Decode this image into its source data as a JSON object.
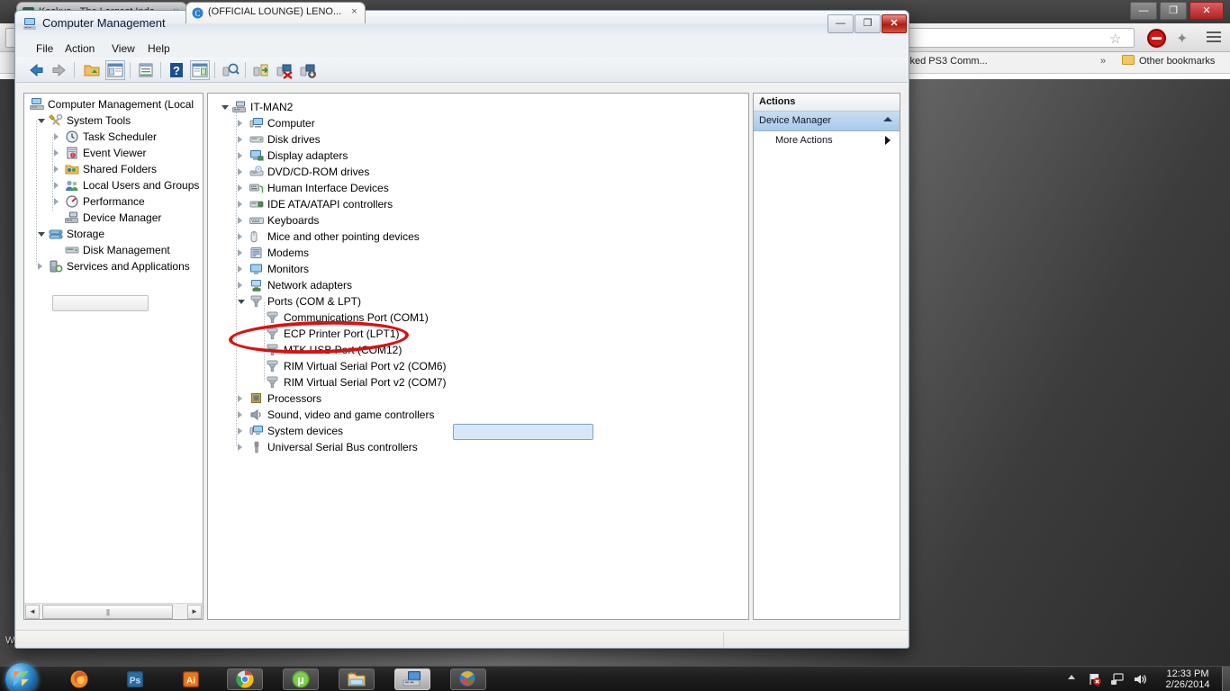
{
  "desktop": {
    "icon_label_partial": "W"
  },
  "browser": {
    "tabs": [
      {
        "title": "Kaskus - The Largest Indo...",
        "close_label": "×",
        "favicon": "kaskus-favicon"
      },
      {
        "title": "(OFFICIAL LOUNGE) LENO...",
        "close_label": "×",
        "favicon": "chrome-page-favicon"
      }
    ],
    "omnibox_value": "",
    "omnibox_placeholder": "",
    "star_glyph": "☆",
    "ext_glyph": "✦",
    "bookmarks": {
      "truncated_item": "cked PS3 Comm...",
      "overflow_glyph": "»",
      "other_bookmarks": "Other bookmarks"
    },
    "window_buttons": {
      "minimize": "—",
      "maximize": "❐",
      "close": "✕"
    }
  },
  "computer_management": {
    "title": "Computer Management",
    "window_buttons": {
      "minimize": "—",
      "maximize": "❐",
      "close": "✕"
    },
    "menu": [
      "File",
      "Action",
      "View",
      "Help"
    ],
    "toolbar_icons": [
      "back-arrow-icon",
      "forward-arrow-icon",
      "up-folder-icon",
      "show-hide-tree-icon",
      "properties-icon",
      "help-icon",
      "show-hide-action-pane-icon",
      "scan-hardware-icon",
      "update-driver-icon",
      "uninstall-device-icon",
      "disable-device-icon"
    ],
    "left_tree": [
      {
        "label": "Computer Management (Local",
        "level": 0,
        "twisty": "none",
        "icon": "computer-management-icon"
      },
      {
        "label": "System Tools",
        "level": 1,
        "twisty": "open",
        "icon": "system-tools-icon"
      },
      {
        "label": "Task Scheduler",
        "level": 2,
        "twisty": "closed",
        "icon": "task-scheduler-icon"
      },
      {
        "label": "Event Viewer",
        "level": 2,
        "twisty": "closed",
        "icon": "event-viewer-icon"
      },
      {
        "label": "Shared Folders",
        "level": 2,
        "twisty": "closed",
        "icon": "shared-folders-icon"
      },
      {
        "label": "Local Users and Groups",
        "level": 2,
        "twisty": "closed",
        "icon": "local-users-groups-icon"
      },
      {
        "label": "Performance",
        "level": 2,
        "twisty": "closed",
        "icon": "performance-icon"
      },
      {
        "label": "Device Manager",
        "level": 2,
        "twisty": "none",
        "icon": "device-manager-icon",
        "selected": true
      },
      {
        "label": "Storage",
        "level": 1,
        "twisty": "open",
        "icon": "storage-icon"
      },
      {
        "label": "Disk Management",
        "level": 2,
        "twisty": "none",
        "icon": "disk-management-icon"
      },
      {
        "label": "Services and Applications",
        "level": 1,
        "twisty": "closed",
        "icon": "services-apps-icon"
      }
    ],
    "left_scrollbar": {
      "left_arrow": "◄",
      "right_arrow": "►"
    },
    "device_tree": [
      {
        "label": "IT-MAN2",
        "level": 0,
        "twisty": "open",
        "icon": "computer-icon"
      },
      {
        "label": "Computer",
        "level": 1,
        "twisty": "closed",
        "icon": "computer-node-icon"
      },
      {
        "label": "Disk drives",
        "level": 1,
        "twisty": "closed",
        "icon": "disk-drive-icon"
      },
      {
        "label": "Display adapters",
        "level": 1,
        "twisty": "closed",
        "icon": "display-adapter-icon"
      },
      {
        "label": "DVD/CD-ROM drives",
        "level": 1,
        "twisty": "closed",
        "icon": "dvd-drive-icon"
      },
      {
        "label": "Human Interface Devices",
        "level": 1,
        "twisty": "closed",
        "icon": "hid-icon"
      },
      {
        "label": "IDE ATA/ATAPI controllers",
        "level": 1,
        "twisty": "closed",
        "icon": "ide-controller-icon"
      },
      {
        "label": "Keyboards",
        "level": 1,
        "twisty": "closed",
        "icon": "keyboard-icon"
      },
      {
        "label": "Mice and other pointing devices",
        "level": 1,
        "twisty": "closed",
        "icon": "mouse-icon"
      },
      {
        "label": "Modems",
        "level": 1,
        "twisty": "closed",
        "icon": "modem-icon"
      },
      {
        "label": "Monitors",
        "level": 1,
        "twisty": "closed",
        "icon": "monitor-icon"
      },
      {
        "label": "Network adapters",
        "level": 1,
        "twisty": "closed",
        "icon": "network-adapter-icon"
      },
      {
        "label": "Ports (COM & LPT)",
        "level": 1,
        "twisty": "open",
        "icon": "port-icon"
      },
      {
        "label": "Communications Port (COM1)",
        "level": 2,
        "twisty": "none",
        "icon": "port-icon"
      },
      {
        "label": "ECP Printer Port (LPT1)",
        "level": 2,
        "twisty": "none",
        "icon": "port-icon"
      },
      {
        "label": "MTK USB Port (COM12)",
        "level": 2,
        "twisty": "none",
        "icon": "port-icon",
        "selected": true
      },
      {
        "label": "RIM Virtual Serial Port v2 (COM6)",
        "level": 2,
        "twisty": "none",
        "icon": "port-icon"
      },
      {
        "label": "RIM Virtual Serial Port v2 (COM7)",
        "level": 2,
        "twisty": "none",
        "icon": "port-icon"
      },
      {
        "label": "Processors",
        "level": 1,
        "twisty": "closed",
        "icon": "processor-icon"
      },
      {
        "label": "Sound, video and game controllers",
        "level": 1,
        "twisty": "closed",
        "icon": "sound-icon"
      },
      {
        "label": "System devices",
        "level": 1,
        "twisty": "closed",
        "icon": "system-device-icon"
      },
      {
        "label": "Universal Serial Bus controllers",
        "level": 1,
        "twisty": "closed",
        "icon": "usb-icon"
      }
    ],
    "actions": {
      "header": "Actions",
      "section": "Device Manager",
      "more_actions": "More Actions"
    },
    "status_left": "",
    "status_right": ""
  },
  "annotation": {
    "shape": "red-ellipse",
    "color": "#d81212",
    "targets": "MTK USB Port (COM12)"
  },
  "taskbar": {
    "start_label": "Start",
    "apps": [
      {
        "name": "firefox",
        "state": "pinned"
      },
      {
        "name": "photoshop",
        "state": "pinned",
        "text": "Ps"
      },
      {
        "name": "illustrator",
        "state": "pinned",
        "text": "Ai"
      },
      {
        "name": "chrome",
        "state": "running"
      },
      {
        "name": "utorrent",
        "state": "running",
        "text": "µ"
      },
      {
        "name": "windows-explorer",
        "state": "running"
      },
      {
        "name": "computer-management",
        "state": "active"
      },
      {
        "name": "internet-download-manager",
        "state": "running"
      }
    ],
    "tray": [
      "action-center-flag-icon",
      "network-icon",
      "volume-icon"
    ],
    "clock_time": "12:33 PM",
    "clock_date": "2/26/2014"
  }
}
